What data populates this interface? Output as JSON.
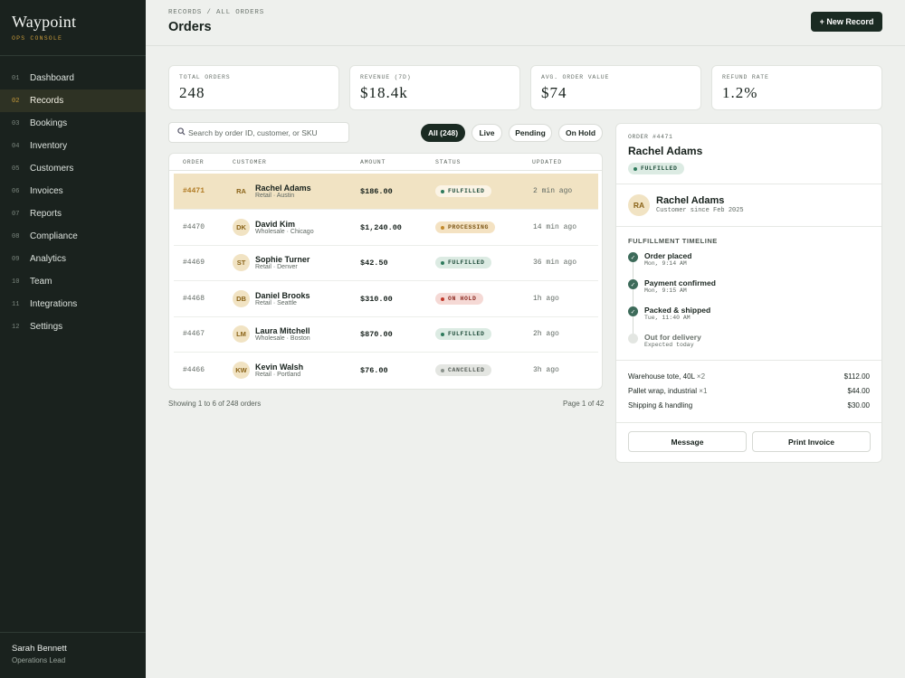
{
  "brand": {
    "name": "Waypoint",
    "subtitle": "OPS CONSOLE"
  },
  "nav": [
    {
      "num": "01",
      "label": "Dashboard",
      "active": false
    },
    {
      "num": "02",
      "label": "Records",
      "active": true
    },
    {
      "num": "03",
      "label": "Bookings",
      "active": false
    },
    {
      "num": "04",
      "label": "Inventory",
      "active": false
    },
    {
      "num": "05",
      "label": "Customers",
      "active": false
    },
    {
      "num": "06",
      "label": "Invoices",
      "active": false
    },
    {
      "num": "07",
      "label": "Reports",
      "active": false
    },
    {
      "num": "08",
      "label": "Compliance",
      "active": false
    },
    {
      "num": "09",
      "label": "Analytics",
      "active": false
    },
    {
      "num": "10",
      "label": "Team",
      "active": false
    },
    {
      "num": "11",
      "label": "Integrations",
      "active": false
    },
    {
      "num": "12",
      "label": "Settings",
      "active": false
    }
  ],
  "user": {
    "name": "Sarah Bennett",
    "role": "Operations Lead"
  },
  "header": {
    "breadcrumb": "RECORDS / ALL ORDERS",
    "title": "Orders",
    "new_button": "+ New Record"
  },
  "kpis": [
    {
      "label": "TOTAL ORDERS",
      "value": "248"
    },
    {
      "label": "REVENUE (7D)",
      "value": "$18.4k"
    },
    {
      "label": "AVG. ORDER VALUE",
      "value": "$74"
    },
    {
      "label": "REFUND RATE",
      "value": "1.2%"
    }
  ],
  "search": {
    "placeholder": "Search by order ID, customer, or SKU",
    "value": ""
  },
  "filters": [
    "All (248)",
    "Live",
    "Pending",
    "On Hold"
  ],
  "table": {
    "columns": [
      "ORDER",
      "CUSTOMER",
      "AMOUNT",
      "STATUS",
      "UPDATED"
    ],
    "rows": [
      {
        "order": "#4471",
        "initials": "RA",
        "name": "Rachel Adams",
        "meta": "Retail · Austin",
        "amount": "$186.00",
        "status": "FULFILLED",
        "updated": "2 min ago"
      },
      {
        "order": "#4470",
        "initials": "DK",
        "name": "David Kim",
        "meta": "Wholesale · Chicago",
        "amount": "$1,240.00",
        "status": "PROCESSING",
        "updated": "14 min ago"
      },
      {
        "order": "#4469",
        "initials": "ST",
        "name": "Sophie Turner",
        "meta": "Retail · Denver",
        "amount": "$42.50",
        "status": "FULFILLED",
        "updated": "36 min ago"
      },
      {
        "order": "#4468",
        "initials": "DB",
        "name": "Daniel Brooks",
        "meta": "Retail · Seattle",
        "amount": "$310.00",
        "status": "ON HOLD",
        "updated": "1h ago"
      },
      {
        "order": "#4467",
        "initials": "LM",
        "name": "Laura Mitchell",
        "meta": "Wholesale · Boston",
        "amount": "$870.00",
        "status": "FULFILLED",
        "updated": "2h ago"
      },
      {
        "order": "#4466",
        "initials": "KW",
        "name": "Kevin Walsh",
        "meta": "Retail · Portland",
        "amount": "$76.00",
        "status": "CANCELLED",
        "updated": "3h ago"
      }
    ],
    "footer_left": "Showing 1 to 6 of 248 orders",
    "footer_right": "Page 1 of 42"
  },
  "detail": {
    "order_label": "ORDER #4471",
    "name": "Rachel Adams",
    "status": "FULFILLED",
    "customer": {
      "initials": "RA",
      "name": "Rachel Adams",
      "since": "Customer since Feb 2025"
    },
    "timeline_title": "FULFILLMENT TIMELINE",
    "timeline": [
      {
        "title": "Order placed",
        "time": "Mon, 9:14 AM",
        "done": true
      },
      {
        "title": "Payment confirmed",
        "time": "Mon, 9:15 AM",
        "done": true
      },
      {
        "title": "Packed & shipped",
        "time": "Tue, 11:40 AM",
        "done": true
      },
      {
        "title": "Out for delivery",
        "time": "Expected today",
        "done": false
      }
    ],
    "line_items": [
      {
        "name": "Warehouse tote, 40L",
        "qty": "×2",
        "price": "$112.00"
      },
      {
        "name": "Pallet wrap, industrial",
        "qty": "×1",
        "price": "$44.00"
      },
      {
        "name": "Shipping & handling",
        "qty": "",
        "price": "$30.00"
      }
    ],
    "buttons": {
      "message": "Message",
      "print": "Print Invoice"
    }
  }
}
